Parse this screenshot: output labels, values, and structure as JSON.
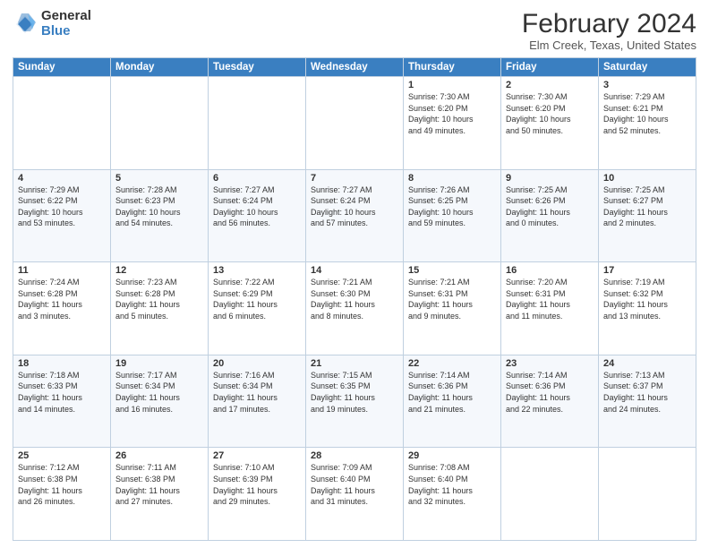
{
  "logo": {
    "general": "General",
    "blue": "Blue"
  },
  "title": "February 2024",
  "subtitle": "Elm Creek, Texas, United States",
  "weekdays": [
    "Sunday",
    "Monday",
    "Tuesday",
    "Wednesday",
    "Thursday",
    "Friday",
    "Saturday"
  ],
  "weeks": [
    [
      {
        "day": "",
        "info": ""
      },
      {
        "day": "",
        "info": ""
      },
      {
        "day": "",
        "info": ""
      },
      {
        "day": "",
        "info": ""
      },
      {
        "day": "1",
        "info": "Sunrise: 7:30 AM\nSunset: 6:20 PM\nDaylight: 10 hours\nand 49 minutes."
      },
      {
        "day": "2",
        "info": "Sunrise: 7:30 AM\nSunset: 6:20 PM\nDaylight: 10 hours\nand 50 minutes."
      },
      {
        "day": "3",
        "info": "Sunrise: 7:29 AM\nSunset: 6:21 PM\nDaylight: 10 hours\nand 52 minutes."
      }
    ],
    [
      {
        "day": "4",
        "info": "Sunrise: 7:29 AM\nSunset: 6:22 PM\nDaylight: 10 hours\nand 53 minutes."
      },
      {
        "day": "5",
        "info": "Sunrise: 7:28 AM\nSunset: 6:23 PM\nDaylight: 10 hours\nand 54 minutes."
      },
      {
        "day": "6",
        "info": "Sunrise: 7:27 AM\nSunset: 6:24 PM\nDaylight: 10 hours\nand 56 minutes."
      },
      {
        "day": "7",
        "info": "Sunrise: 7:27 AM\nSunset: 6:24 PM\nDaylight: 10 hours\nand 57 minutes."
      },
      {
        "day": "8",
        "info": "Sunrise: 7:26 AM\nSunset: 6:25 PM\nDaylight: 10 hours\nand 59 minutes."
      },
      {
        "day": "9",
        "info": "Sunrise: 7:25 AM\nSunset: 6:26 PM\nDaylight: 11 hours\nand 0 minutes."
      },
      {
        "day": "10",
        "info": "Sunrise: 7:25 AM\nSunset: 6:27 PM\nDaylight: 11 hours\nand 2 minutes."
      }
    ],
    [
      {
        "day": "11",
        "info": "Sunrise: 7:24 AM\nSunset: 6:28 PM\nDaylight: 11 hours\nand 3 minutes."
      },
      {
        "day": "12",
        "info": "Sunrise: 7:23 AM\nSunset: 6:28 PM\nDaylight: 11 hours\nand 5 minutes."
      },
      {
        "day": "13",
        "info": "Sunrise: 7:22 AM\nSunset: 6:29 PM\nDaylight: 11 hours\nand 6 minutes."
      },
      {
        "day": "14",
        "info": "Sunrise: 7:21 AM\nSunset: 6:30 PM\nDaylight: 11 hours\nand 8 minutes."
      },
      {
        "day": "15",
        "info": "Sunrise: 7:21 AM\nSunset: 6:31 PM\nDaylight: 11 hours\nand 9 minutes."
      },
      {
        "day": "16",
        "info": "Sunrise: 7:20 AM\nSunset: 6:31 PM\nDaylight: 11 hours\nand 11 minutes."
      },
      {
        "day": "17",
        "info": "Sunrise: 7:19 AM\nSunset: 6:32 PM\nDaylight: 11 hours\nand 13 minutes."
      }
    ],
    [
      {
        "day": "18",
        "info": "Sunrise: 7:18 AM\nSunset: 6:33 PM\nDaylight: 11 hours\nand 14 minutes."
      },
      {
        "day": "19",
        "info": "Sunrise: 7:17 AM\nSunset: 6:34 PM\nDaylight: 11 hours\nand 16 minutes."
      },
      {
        "day": "20",
        "info": "Sunrise: 7:16 AM\nSunset: 6:34 PM\nDaylight: 11 hours\nand 17 minutes."
      },
      {
        "day": "21",
        "info": "Sunrise: 7:15 AM\nSunset: 6:35 PM\nDaylight: 11 hours\nand 19 minutes."
      },
      {
        "day": "22",
        "info": "Sunrise: 7:14 AM\nSunset: 6:36 PM\nDaylight: 11 hours\nand 21 minutes."
      },
      {
        "day": "23",
        "info": "Sunrise: 7:14 AM\nSunset: 6:36 PM\nDaylight: 11 hours\nand 22 minutes."
      },
      {
        "day": "24",
        "info": "Sunrise: 7:13 AM\nSunset: 6:37 PM\nDaylight: 11 hours\nand 24 minutes."
      }
    ],
    [
      {
        "day": "25",
        "info": "Sunrise: 7:12 AM\nSunset: 6:38 PM\nDaylight: 11 hours\nand 26 minutes."
      },
      {
        "day": "26",
        "info": "Sunrise: 7:11 AM\nSunset: 6:38 PM\nDaylight: 11 hours\nand 27 minutes."
      },
      {
        "day": "27",
        "info": "Sunrise: 7:10 AM\nSunset: 6:39 PM\nDaylight: 11 hours\nand 29 minutes."
      },
      {
        "day": "28",
        "info": "Sunrise: 7:09 AM\nSunset: 6:40 PM\nDaylight: 11 hours\nand 31 minutes."
      },
      {
        "day": "29",
        "info": "Sunrise: 7:08 AM\nSunset: 6:40 PM\nDaylight: 11 hours\nand 32 minutes."
      },
      {
        "day": "",
        "info": ""
      },
      {
        "day": "",
        "info": ""
      }
    ]
  ]
}
